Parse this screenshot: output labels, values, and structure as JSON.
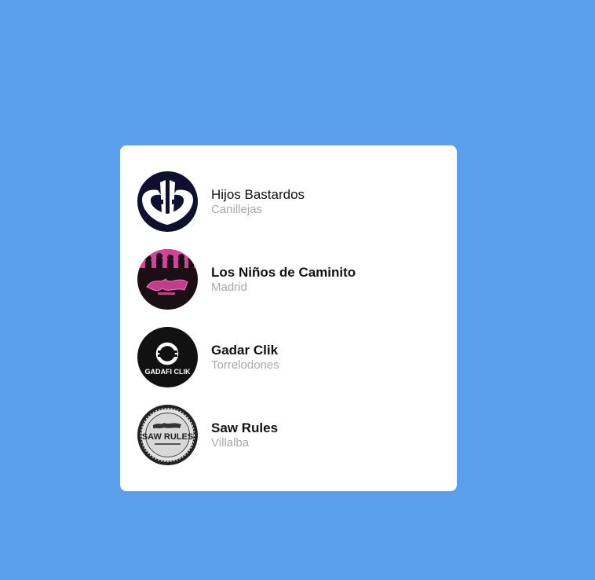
{
  "page": {
    "background_color": "#5b9eec"
  },
  "artists": [
    {
      "name": "Hijos Bastardos",
      "location": "Canillejas",
      "avatar_icon": "hb-logo-icon",
      "emphasized": false
    },
    {
      "name": "Los Niños de Caminito",
      "location": "Madrid",
      "avatar_icon": "group-photo-avatar",
      "emphasized": true
    },
    {
      "name": "Gadar Clik",
      "location": "Torrelodones",
      "avatar_icon": "gadafi-clik-logo-icon",
      "emphasized": true,
      "avatar_text": "GADAFI CLIK"
    },
    {
      "name": "Saw Rules",
      "location": "Villalba",
      "avatar_icon": "saw-rules-logo-icon",
      "emphasized": true,
      "avatar_text": "SAW RULES"
    }
  ]
}
